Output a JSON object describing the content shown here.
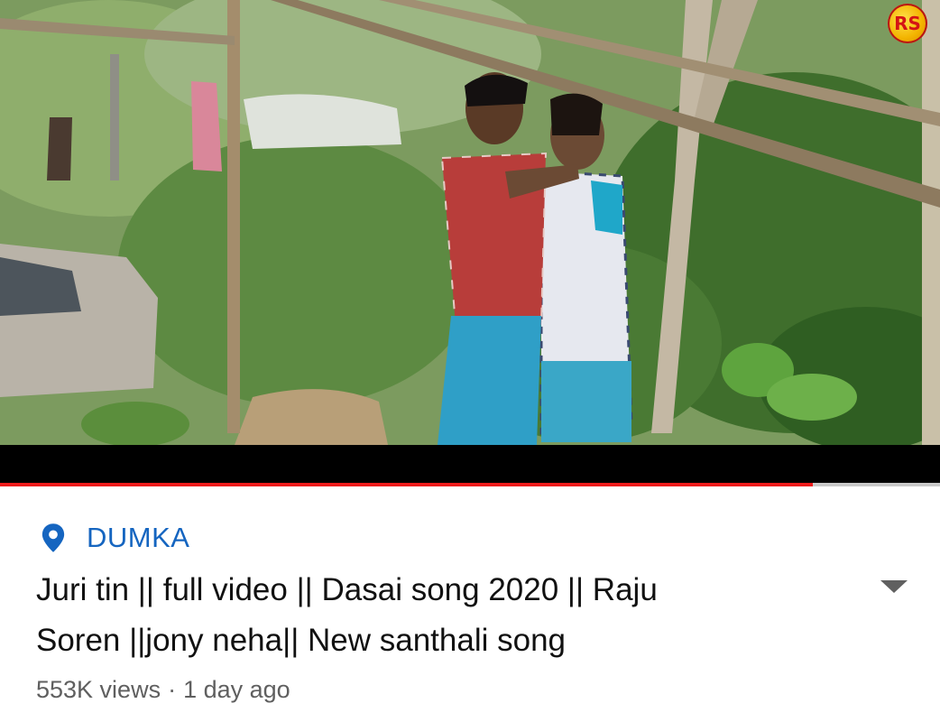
{
  "video": {
    "watermark_text": "RS",
    "progress_fraction": 0.865
  },
  "location": {
    "icon": "location-pin-icon",
    "label": "DUMKA",
    "color": "#1565c0"
  },
  "video_title": {
    "line1": "Juri tin || full video || Dasai song 2020 || Raju",
    "line2": "Soren ||jony neha|| New santhali song"
  },
  "meta": {
    "views": "553K views",
    "separator": "·",
    "age": "1 day ago"
  },
  "expand": {
    "icon": "chevron-down-icon"
  },
  "colors": {
    "progress": "#ee1b1b",
    "track": "#c9c9c9",
    "title": "#111111",
    "meta": "#5f5f5f"
  }
}
